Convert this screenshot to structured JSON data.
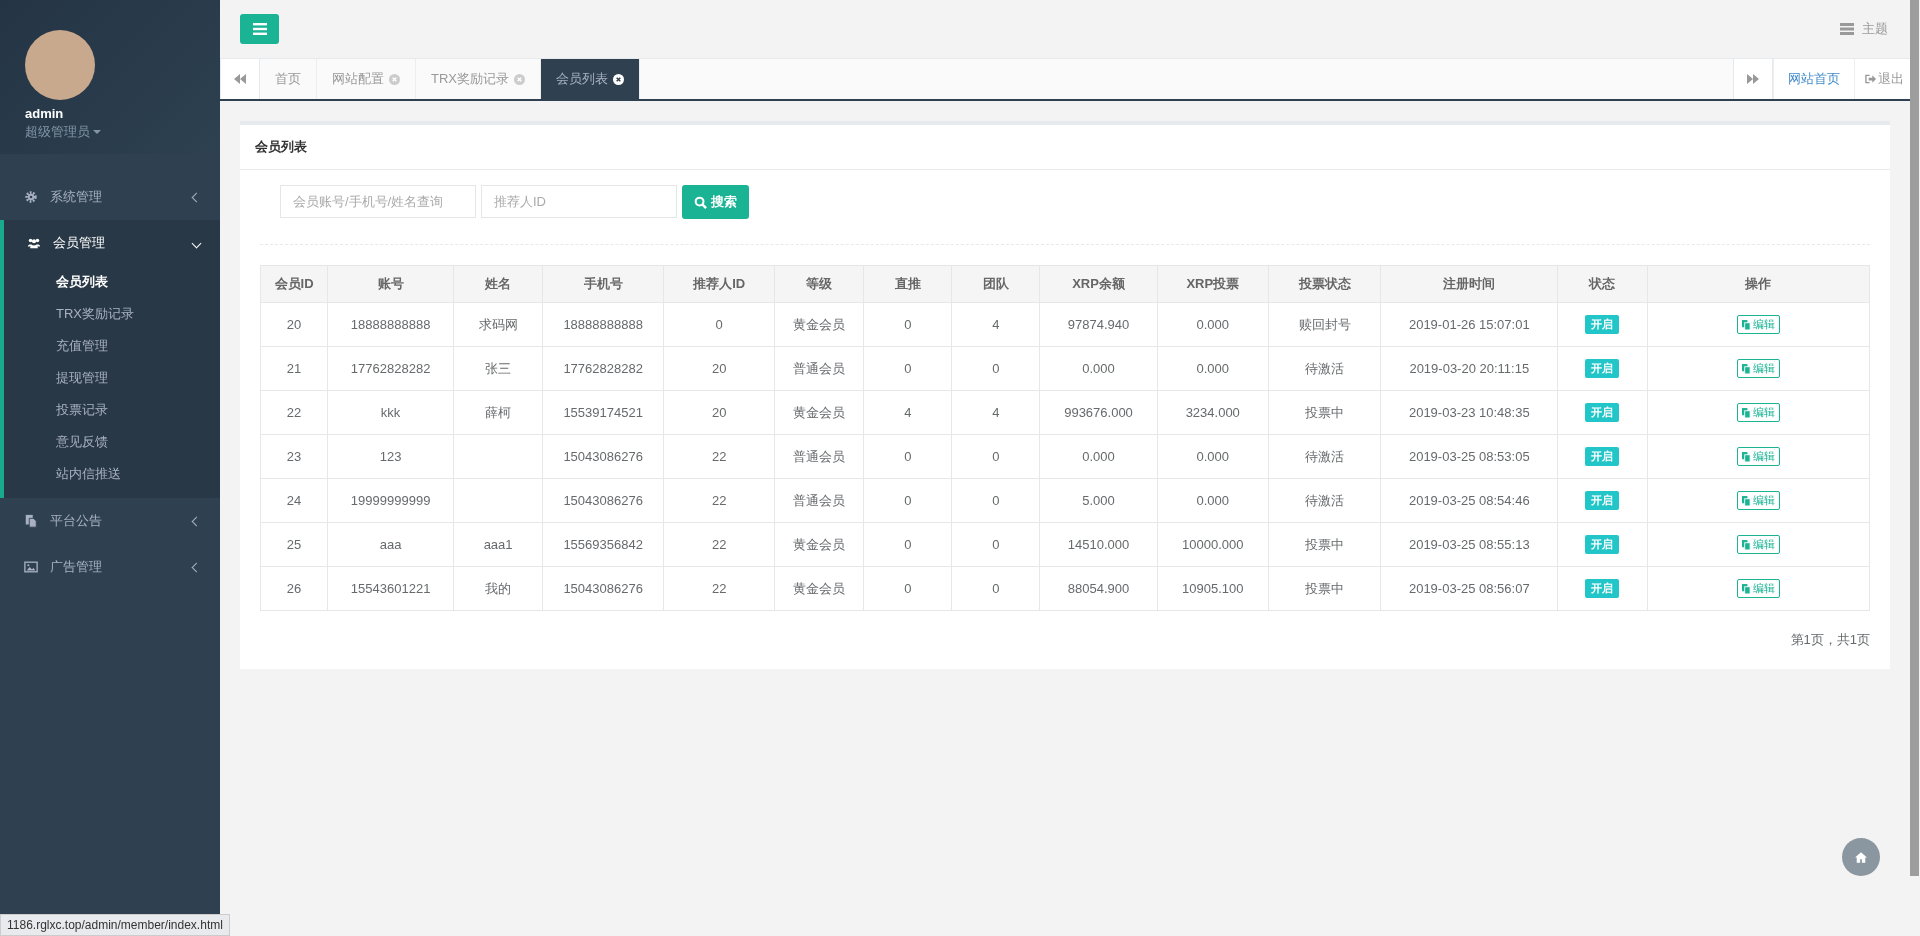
{
  "user": {
    "name": "admin",
    "role": "超级管理员"
  },
  "menu": [
    {
      "label": "系统管理",
      "expanded": false
    },
    {
      "label": "会员管理",
      "expanded": true,
      "children": [
        {
          "label": "会员列表",
          "selected": true
        },
        {
          "label": "TRX奖励记录",
          "selected": false
        },
        {
          "label": "充值管理",
          "selected": false
        },
        {
          "label": "提现管理",
          "selected": false
        },
        {
          "label": "投票记录",
          "selected": false
        },
        {
          "label": "意见反馈",
          "selected": false
        },
        {
          "label": "站内信推送",
          "selected": false
        }
      ]
    },
    {
      "label": "平台公告",
      "expanded": false
    },
    {
      "label": "广告管理",
      "expanded": false
    }
  ],
  "topbar": {
    "theme": "主题"
  },
  "tabs": [
    {
      "label": "首页",
      "selected": false,
      "closable": false
    },
    {
      "label": "网站配置",
      "selected": false,
      "closable": true
    },
    {
      "label": "TRX奖励记录",
      "selected": false,
      "closable": true
    },
    {
      "label": "会员列表",
      "selected": true,
      "closable": true
    }
  ],
  "tab_actions": {
    "home": "网站首页",
    "logout": "退出"
  },
  "panel": {
    "title": "会员列表",
    "search": {
      "placeholder": "会员账号/手机号/姓名查询"
    },
    "referrer": {
      "placeholder": "推荐人ID"
    },
    "search_button": "搜索"
  },
  "table": {
    "columns": [
      "会员ID",
      "账号",
      "姓名",
      "手机号",
      "推荐人ID",
      "等级",
      "直推",
      "团队",
      "XRP余额",
      "XRP投票",
      "投票状态",
      "注册时间",
      "状态",
      "操作"
    ],
    "rows": [
      {
        "cells": [
          "20",
          "18888888888",
          "求码网",
          "18888888888",
          "0",
          "黄金会员",
          "0",
          "4",
          "97874.940",
          "0.000",
          "赎回封号",
          "2019-01-26 15:07:01"
        ],
        "status": "开启",
        "action": "编辑"
      },
      {
        "cells": [
          "21",
          "17762828282",
          "张三",
          "17762828282",
          "20",
          "普通会员",
          "0",
          "0",
          "0.000",
          "0.000",
          "待激活",
          "2019-03-20 20:11:15"
        ],
        "status": "开启",
        "action": "编辑"
      },
      {
        "cells": [
          "22",
          "kkk",
          "薛柯",
          "15539174521",
          "20",
          "黄金会员",
          "4",
          "4",
          "993676.000",
          "3234.000",
          "投票中",
          "2019-03-23 10:48:35"
        ],
        "status": "开启",
        "action": "编辑"
      },
      {
        "cells": [
          "23",
          "123",
          "",
          "15043086276",
          "22",
          "普通会员",
          "0",
          "0",
          "0.000",
          "0.000",
          "待激活",
          "2019-03-25 08:53:05"
        ],
        "status": "开启",
        "action": "编辑"
      },
      {
        "cells": [
          "24",
          "19999999999",
          "",
          "15043086276",
          "22",
          "普通会员",
          "0",
          "0",
          "5.000",
          "0.000",
          "待激活",
          "2019-03-25 08:54:46"
        ],
        "status": "开启",
        "action": "编辑"
      },
      {
        "cells": [
          "25",
          "aaa",
          "aaa1",
          "15569356842",
          "22",
          "黄金会员",
          "0",
          "0",
          "14510.000",
          "10000.000",
          "投票中",
          "2019-03-25 08:55:13"
        ],
        "status": "开启",
        "action": "编辑"
      },
      {
        "cells": [
          "26",
          "15543601221",
          "我的",
          "15043086276",
          "22",
          "黄金会员",
          "0",
          "0",
          "88054.900",
          "10905.100",
          "投票中",
          "2019-03-25 08:56:07"
        ],
        "status": "开启",
        "action": "编辑"
      }
    ]
  },
  "pagination": "第1页，共1页",
  "status_bar": "1186.rglxc.top/admin/member/index.html"
}
